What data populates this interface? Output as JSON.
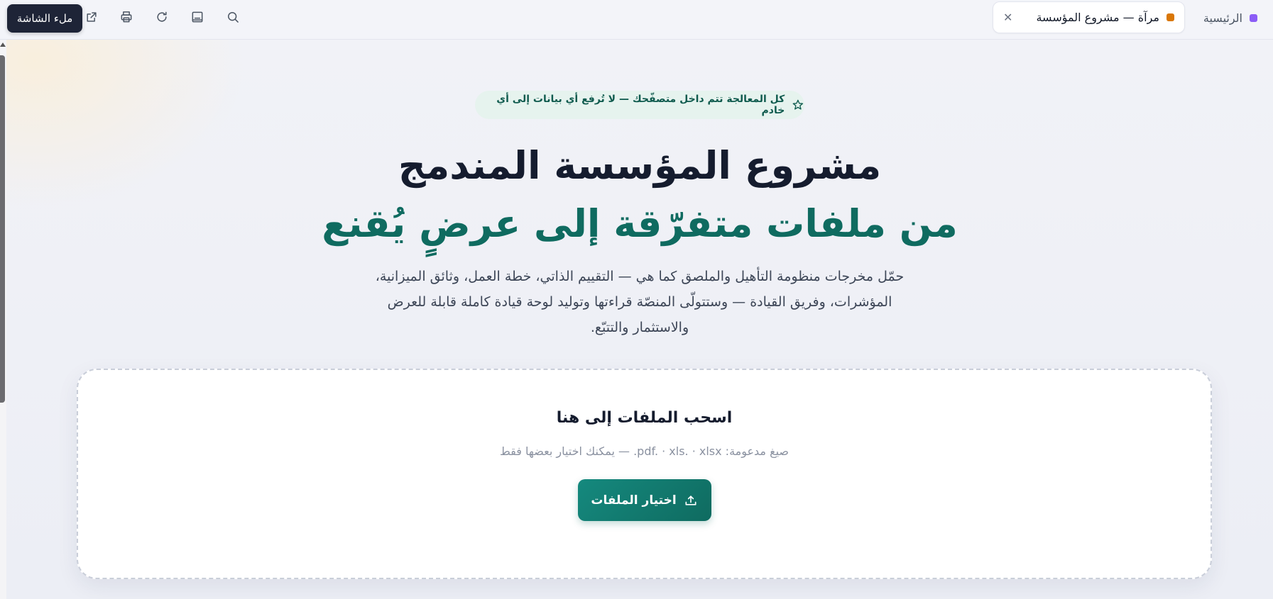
{
  "header": {
    "home_label": "الرئيسية",
    "home_dot_color": "#8b5cf6",
    "tab": {
      "title": "مرآة — مشروع المؤسسة",
      "dot_color": "#d97706",
      "close_glyph": "✕"
    },
    "fullscreen_label": "ملء الشاشة",
    "toolbar_icons": [
      "search-icon",
      "notes-icon",
      "reload-icon",
      "print-icon",
      "external-link-icon"
    ]
  },
  "hero": {
    "privacy_note": "كل المعالجة تتم داخل متصفّحك — لا تُرفع أي بيانات إلى أي خادم",
    "title_line1": "مشروع المؤسسة المندمج",
    "title_line2": "من ملفات متفرّقة إلى عرضٍ يُقنع",
    "description": "حمّل مخرجات منظومة التأهيل والملصق كما هي — التقييم الذاتي، خطة العمل، وثائق الميزانية، المؤشرات، وفريق القيادة — وستتولّى المنصّة قراءتها وتوليد لوحة قيادة كاملة قابلة للعرض والاستثمار والتتبّع."
  },
  "dropzone": {
    "title": "اسحب الملفات إلى هنا",
    "formats": "صيغ مدعومة: pdf. · xls. · xlsx. — يمكنك اختيار بعضها فقط",
    "button_label": "اختيار الملفات"
  },
  "colors": {
    "accent": "#0f6b60",
    "title_dark": "#151c2e"
  }
}
